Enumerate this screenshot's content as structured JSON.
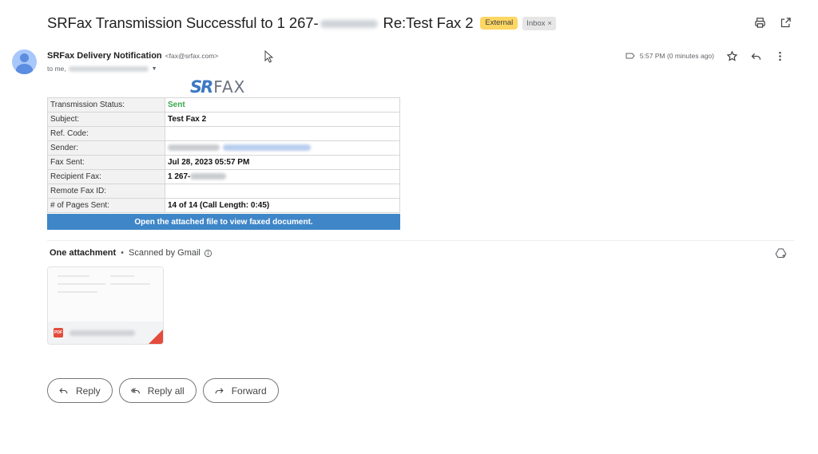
{
  "email": {
    "subject_prefix": "SRFax Transmission Successful to 1 267-",
    "subject_suffix": " Re:Test Fax 2",
    "labels": {
      "external": "External",
      "inbox": "Inbox",
      "inbox_close": "×"
    },
    "sender_name": "SRFax Delivery Notification",
    "sender_email": "<fax@srfax.com>",
    "to_prefix": "to me,",
    "timestamp": "5:57 PM (0 minutes ago)"
  },
  "logo": {
    "sr": "SR",
    "fax": "FAX"
  },
  "fax_report": {
    "rows": [
      {
        "key": "Transmission Status:",
        "value": "Sent"
      },
      {
        "key": "Subject:",
        "value": "Test Fax 2"
      },
      {
        "key": "Ref. Code:",
        "value": ""
      },
      {
        "key": "Sender:",
        "value": ""
      },
      {
        "key": "Fax Sent:",
        "value": "Jul 28, 2023 05:57 PM"
      },
      {
        "key": "Recipient Fax:",
        "value": "1 267-"
      },
      {
        "key": "Remote Fax ID:",
        "value": ""
      },
      {
        "key": "# of Pages Sent:",
        "value": "14 of 14 (Call Length: 0:45)"
      }
    ],
    "footer": "Open the attached file to view faxed document."
  },
  "attachments": {
    "title": "One attachment",
    "separator": "•",
    "scanned": "Scanned by Gmail",
    "file_badge": "PDF"
  },
  "actions": {
    "reply": "Reply",
    "reply_all": "Reply all",
    "forward": "Forward"
  },
  "icons": {
    "print": "print-icon",
    "open_new_window": "open-in-new-icon",
    "label": "label-icon",
    "star": "star-icon",
    "reply": "reply-icon",
    "more": "more-vert-icon",
    "info": "info-icon",
    "add_to_drive": "add-to-drive-icon"
  },
  "colors": {
    "external_label": "#fdd663",
    "sent_status": "#3aa54b",
    "footer_bar": "#3e86c8",
    "logo_blue": "#3b78c4",
    "pdf_red": "#e54b3c"
  }
}
